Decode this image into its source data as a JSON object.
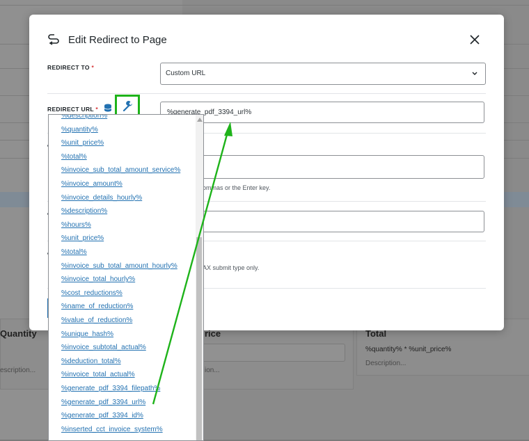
{
  "background": {
    "headings": [
      "Quantity",
      "rice",
      "Total"
    ],
    "total_formula": "%quantity% * %unit_price%",
    "placeholders": [
      "escription...",
      "ion...",
      "Description..."
    ]
  },
  "modal": {
    "title": "Edit Redirect to Page",
    "redirect_to": {
      "label": "REDIRECT TO",
      "required_mark": "*",
      "value": "Custom URL"
    },
    "redirect_url": {
      "label": "REDIRECT URL",
      "required_mark": "*",
      "value": "%generate_pdf_3394_url%"
    },
    "partial_texts": [
      "ommas or the Enter key.",
      "AX submit type only."
    ]
  },
  "macros": [
    "%description%",
    "%quantity%",
    "%unit_price%",
    "%total%",
    "%invoice_sub_total_amount_service%",
    "%invoice_amount%",
    "%invoice_details_hourly%",
    "%description%",
    "%hours%",
    "%unit_price%",
    "%total%",
    "%invoice_sub_total_amount_hourly%",
    "%invoice_total_hourly%",
    "%cost_reductions%",
    "%name_of_reduction%",
    "%value_of_reduction%",
    "%unique_hash%",
    "%invoice_subtotal_actual%",
    "%deduction_total%",
    "%invoice_total_actual%",
    "%generate_pdf_3394_filepath%",
    "%generate_pdf_3394_url%",
    "%generate_pdf_3394_id%",
    "%inserted_cct_invoice_system%"
  ],
  "icons": {
    "redirect": "redirect-arrow-icon",
    "close": "close-icon",
    "database": "database-icon",
    "wrench": "wrench-icon",
    "chevron": "chevron-down-icon"
  },
  "colors": {
    "highlight": "#1eb31a",
    "link": "#2271b1",
    "required": "#d63638"
  }
}
